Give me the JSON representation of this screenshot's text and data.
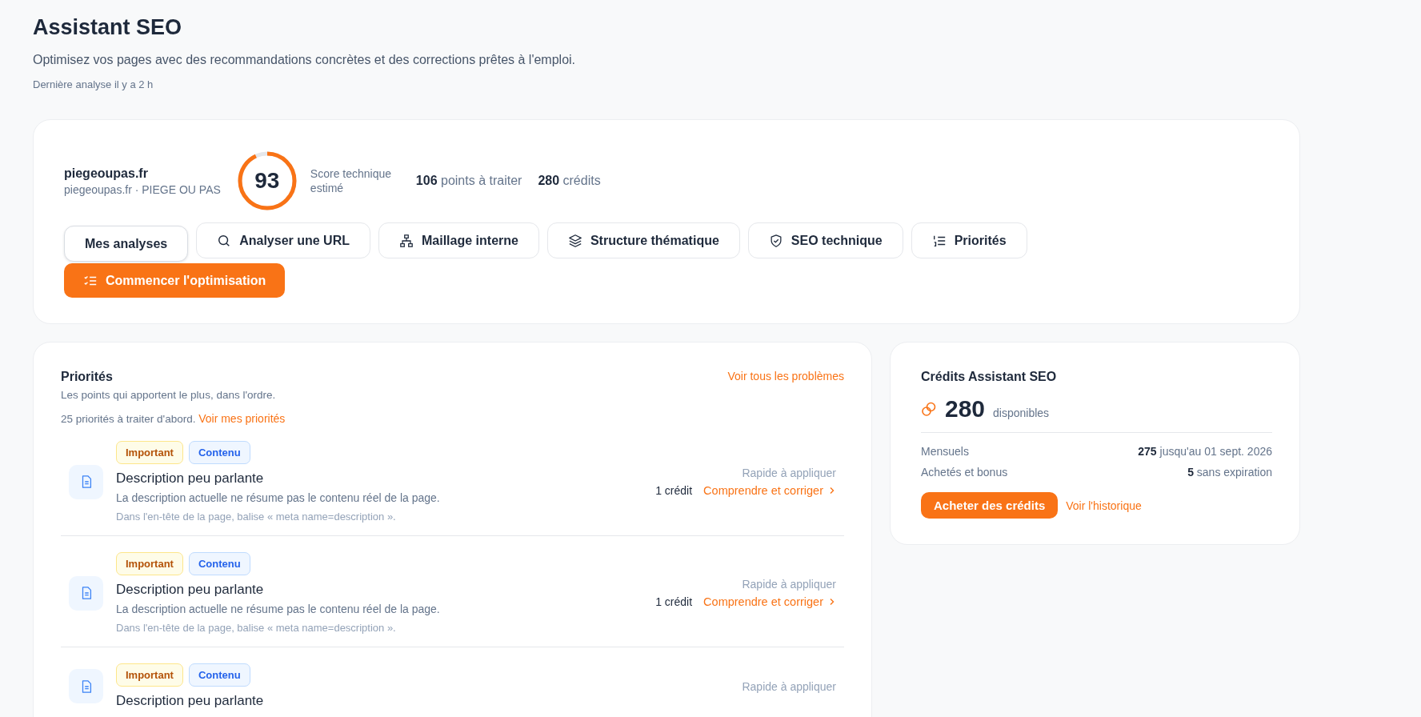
{
  "header": {
    "title": "Assistant SEO",
    "subtitle": "Optimisez vos pages avec des recommandations concrètes et des corrections prêtes à l'emploi.",
    "last_analysis": "Dernière analyse il y a 2 h"
  },
  "site": {
    "name": "piegeoupas.fr",
    "detail": "piegeoupas.fr · PIEGE OU PAS",
    "score": "93",
    "level": 0.93,
    "score_label": "Score technique estimé",
    "points_count": "106",
    "points_label": "points à traiter",
    "credits_count": "280",
    "credits_label": "crédits"
  },
  "tabs": [
    {
      "label": "Mes analyses",
      "selected": true
    },
    {
      "label": "Analyser une URL",
      "selected": false
    },
    {
      "label": "Maillage interne",
      "selected": false
    },
    {
      "label": "Structure thématique",
      "selected": false
    },
    {
      "label": "SEO technique",
      "selected": false
    },
    {
      "label": "Priorités",
      "selected": false
    }
  ],
  "primary_action": "Commencer l'optimisation",
  "priorities": {
    "title": "Priorités",
    "subtitle": "Les points qui apportent le plus, dans l'ordre.",
    "summary": "25 priorités à traiter d'abord.",
    "summary_link": "Voir mes priorités",
    "see_all": "Voir tous les problèmes",
    "items": [
      {
        "tags": [
          {
            "label": "Important",
            "kind": "severity"
          },
          {
            "label": "Contenu",
            "kind": "category"
          }
        ],
        "title": "Description peu parlante",
        "description": "La description actuelle ne résume pas le contenu réel de la page.",
        "location": "Dans l'en-tête de la page, balise « meta name=description ».",
        "effort": "Rapide à appliquer",
        "cost": "1 crédit",
        "action": "Comprendre et corriger"
      },
      {
        "tags": [
          {
            "label": "Important",
            "kind": "severity"
          },
          {
            "label": "Contenu",
            "kind": "category"
          }
        ],
        "title": "Description peu parlante",
        "description": "La description actuelle ne résume pas le contenu réel de la page.",
        "location": "Dans l'en-tête de la page, balise « meta name=description ».",
        "effort": "Rapide à appliquer",
        "cost": "1 crédit",
        "action": "Comprendre et corriger"
      },
      {
        "tags": [
          {
            "label": "Important",
            "kind": "severity"
          },
          {
            "label": "Contenu",
            "kind": "category"
          }
        ],
        "title": "Description peu parlante",
        "effort": "Rapide à appliquer"
      }
    ]
  },
  "credits": {
    "title": "Crédits Assistant SEO",
    "amount": "280",
    "amount_label": "disponibles",
    "rows": [
      {
        "label": "Mensuels",
        "value": "275",
        "note": "jusqu'au 01 sept. 2026"
      },
      {
        "label": "Achetés et bonus",
        "value": "5",
        "note": "sans expiration"
      }
    ],
    "buy": "Acheter des crédits",
    "history": "Voir l'historique"
  }
}
